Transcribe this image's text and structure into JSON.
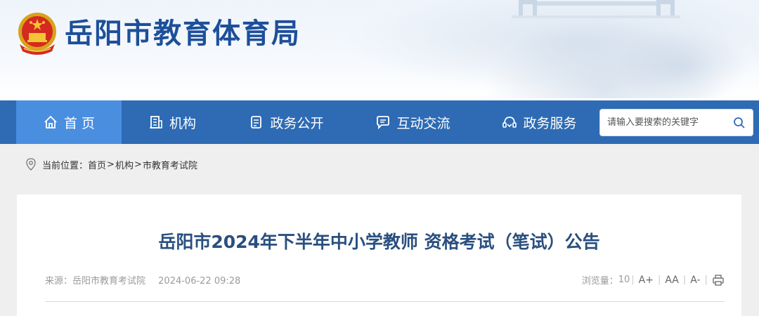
{
  "header": {
    "site_title": "岳阳市教育体育局"
  },
  "nav": {
    "items": [
      {
        "label": "首 页",
        "icon": "home-icon"
      },
      {
        "label": "机构",
        "icon": "organization-icon"
      },
      {
        "label": "政务公开",
        "icon": "document-icon"
      },
      {
        "label": "互动交流",
        "icon": "chat-icon"
      },
      {
        "label": "政务服务",
        "icon": "service-icon"
      }
    ],
    "search_placeholder": "请输入要搜索的关键字"
  },
  "breadcrumb": {
    "label": "当前位置：",
    "items": [
      "首页",
      "机构",
      "市教育考试院"
    ],
    "separator": ">"
  },
  "article": {
    "title": "岳阳市2024年下半年中小学教师 资格考试（笔试）公告",
    "source_label": "来源：岳阳市教育考试院",
    "date": "2024-06-22 09:28",
    "views_label": "浏览量：",
    "views": "10",
    "font_increase": "A+",
    "font_reset": "AA",
    "font_decrease": "A-"
  },
  "colors": {
    "nav_bg": "#2e6bb4",
    "nav_active": "#4a8ee0",
    "title_blue": "#1d4f9a"
  }
}
